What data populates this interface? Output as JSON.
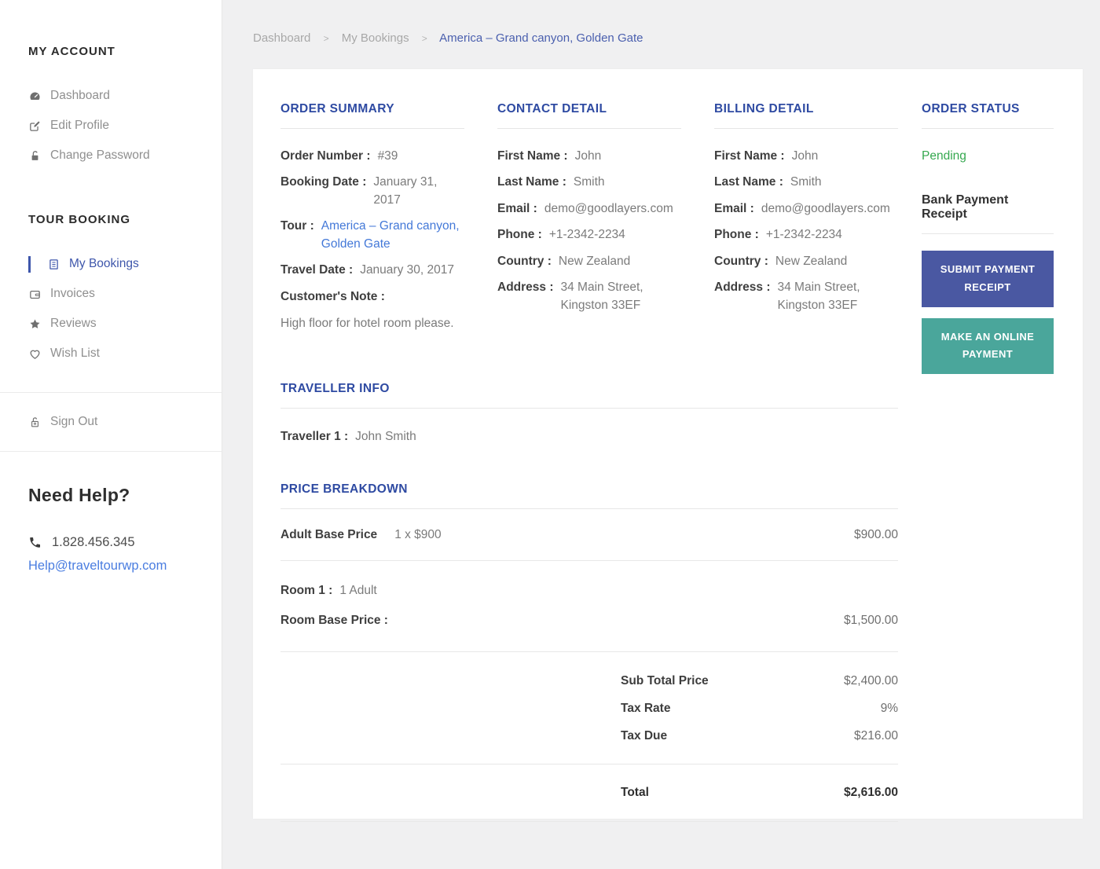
{
  "colors": {
    "accent_heading": "#2e4aa2",
    "active_item": "#3e56ab",
    "link_blue": "#4479d8",
    "status_green": "#35a84f",
    "button_indigo": "#4a58a2",
    "button_teal": "#4aa69b",
    "page_background": "#f0f0f1"
  },
  "sidebar": {
    "account": {
      "title": "MY ACCOUNT",
      "items": [
        {
          "label": "Dashboard",
          "icon": "dashboard-icon"
        },
        {
          "label": "Edit Profile",
          "icon": "edit-icon"
        },
        {
          "label": "Change Password",
          "icon": "lock-icon"
        }
      ]
    },
    "booking": {
      "title": "TOUR BOOKING",
      "items": [
        {
          "label": "My Bookings",
          "icon": "bookings-icon",
          "active": true
        },
        {
          "label": "Invoices",
          "icon": "wallet-icon"
        },
        {
          "label": "Reviews",
          "icon": "star-icon"
        },
        {
          "label": "Wish List",
          "icon": "heart-icon"
        }
      ]
    },
    "signout_label": "Sign Out",
    "help": {
      "title": "Need Help?",
      "phone": "1.828.456.345",
      "email": "Help@traveltourwp.com"
    }
  },
  "breadcrumb": {
    "separator": ">",
    "dashboard": "Dashboard",
    "my_bookings": "My Bookings",
    "current": "America – Grand canyon, Golden Gate"
  },
  "order_summary": {
    "title": "ORDER SUMMARY",
    "order_number_label": "Order Number :",
    "order_number": "#39",
    "booking_date_label": "Booking Date :",
    "booking_date": "January 31, 2017",
    "tour_label": "Tour :",
    "tour": "America – Grand canyon, Golden Gate",
    "travel_date_label": "Travel Date :",
    "travel_date": "January 30, 2017",
    "customers_note_label": "Customer's Note :",
    "customers_note": "High floor for hotel room please."
  },
  "contact_detail": {
    "title": "CONTACT DETAIL",
    "first_name_label": "First Name :",
    "first_name": "John",
    "last_name_label": "Last Name :",
    "last_name": "Smith",
    "email_label": "Email :",
    "email": "demo@goodlayers.com",
    "phone_label": "Phone :",
    "phone": "+1-2342-2234",
    "country_label": "Country :",
    "country": "New Zealand",
    "address_label": "Address :",
    "address": "34 Main Street, Kingston 33EF"
  },
  "billing_detail": {
    "title": "BILLING DETAIL",
    "first_name_label": "First Name :",
    "first_name": "John",
    "last_name_label": "Last Name :",
    "last_name": "Smith",
    "email_label": "Email :",
    "email": "demo@goodlayers.com",
    "phone_label": "Phone :",
    "phone": "+1-2342-2234",
    "country_label": "Country :",
    "country": "New Zealand",
    "address_label": "Address :",
    "address": "34 Main Street, Kingston 33EF"
  },
  "order_status": {
    "title": "ORDER STATUS",
    "status": "Pending",
    "bank_receipt_label": "Bank Payment Receipt",
    "submit_button": "SUBMIT PAYMENT RECEIPT",
    "online_button": "MAKE AN ONLINE PAYMENT"
  },
  "traveller_info": {
    "title": "TRAVELLER INFO",
    "traveller1_label": "Traveller 1 :",
    "traveller1": "John Smith"
  },
  "price_breakdown": {
    "title": "PRICE BREAKDOWN",
    "adult_base_label": "Adult Base Price",
    "adult_base_qty": "1 x $900",
    "adult_base_amount": "$900.00",
    "room1_label": "Room 1 :",
    "room1_value": "1 Adult",
    "room_base_label": "Room Base Price :",
    "room_base_amount": "$1,500.00",
    "subtotal_label": "Sub Total Price",
    "subtotal": "$2,400.00",
    "tax_rate_label": "Tax Rate",
    "tax_rate": "9%",
    "tax_due_label": "Tax Due",
    "tax_due": "$216.00",
    "total_label": "Total",
    "total": "$2,616.00"
  }
}
